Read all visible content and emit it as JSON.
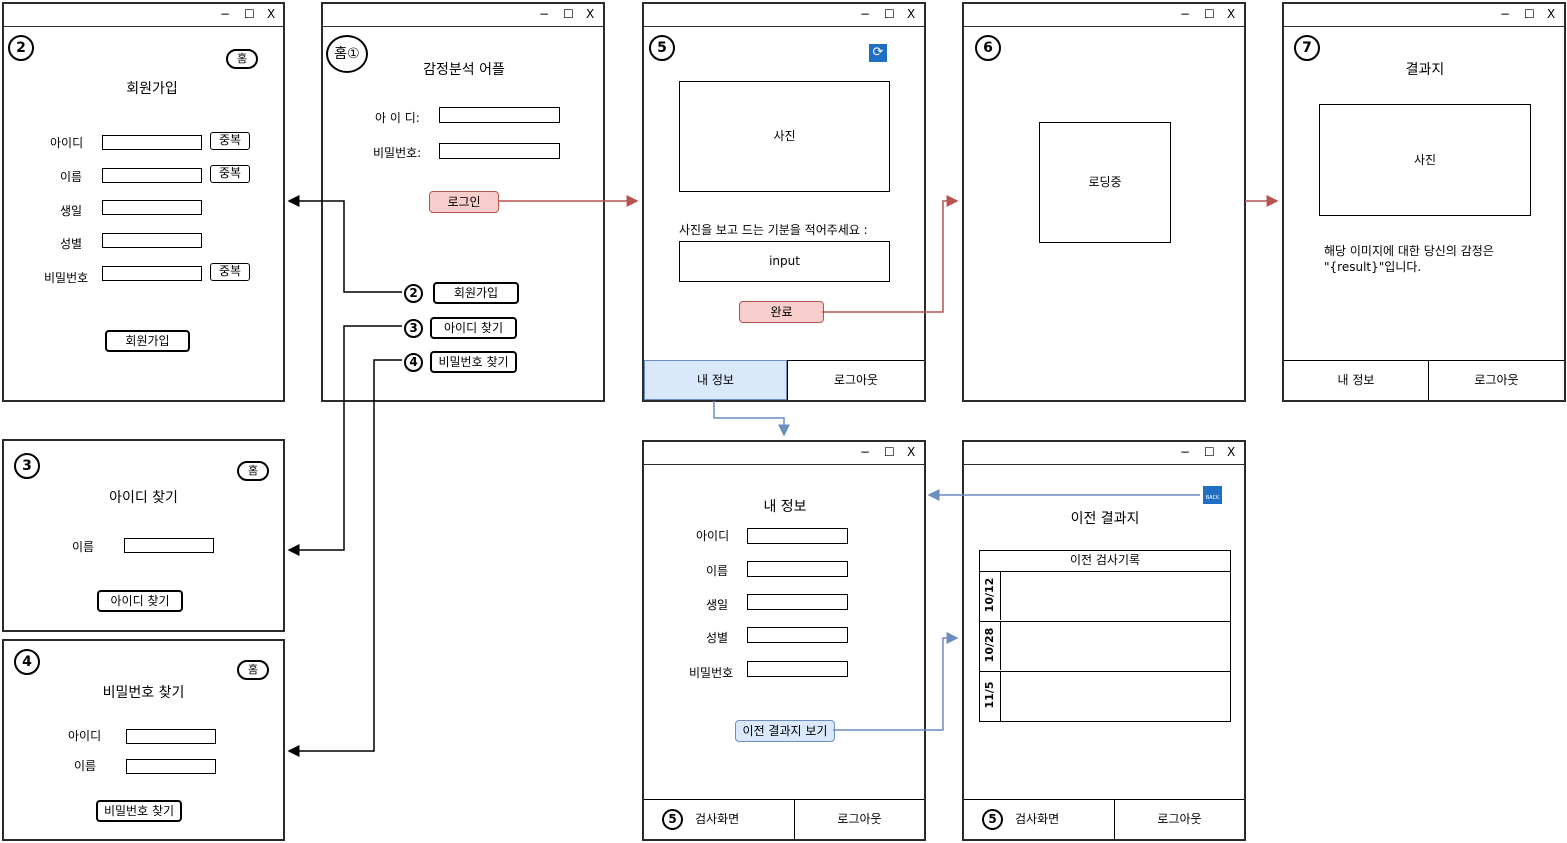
{
  "window_controls": {
    "min": "−",
    "max": "☐",
    "close": "X"
  },
  "home": {
    "num": "홈①",
    "title": "감정분석 어플",
    "id_label": "아 이 디:",
    "pw_label": "비밀번호:",
    "login_button": "로그인",
    "signup_num": "2",
    "signup_button": "회원가입",
    "findid_num": "3",
    "findid_button": "아이디 찾기",
    "findpw_num": "4",
    "findpw_button": "비밀번호 찾기"
  },
  "signup": {
    "num": "2",
    "home_button": "홈",
    "title": "회원가입",
    "fields": [
      "아이디",
      "이름",
      "생일",
      "성별",
      "비밀번호"
    ],
    "dup_button": "중복",
    "submit_button": "회원가입"
  },
  "find_id": {
    "num": "3",
    "home_button": "홈",
    "title": "아이디 찾기",
    "name_label": "이름",
    "submit_button": "아이디 찾기"
  },
  "find_pw": {
    "num": "4",
    "home_button": "홈",
    "title": "비밀번호 찾기",
    "id_label": "아이디",
    "name_label": "이름",
    "submit_button": "비밀번호 찾기"
  },
  "screen5": {
    "num": "5",
    "photo": "사진",
    "prompt": "사진을 보고 드는 기분을 적어주세요 :",
    "input": "input",
    "done_button": "완료",
    "tab_my": "내 정보",
    "tab_logout": "로그아웃"
  },
  "screen6": {
    "num": "6",
    "loading": "로딩중"
  },
  "screen7": {
    "num": "7",
    "title": "결과지",
    "photo": "사진",
    "result_line1": "해당 이미지에 대한 당신의 감정은",
    "result_line2": "\"{result}\"입니다.",
    "tab_my": "내 정보",
    "tab_logout": "로그아웃"
  },
  "my_info": {
    "title": "내 정보",
    "fields": [
      "아이디",
      "이름",
      "생일",
      "성별",
      "비밀번호"
    ],
    "prev_button": "이전 결과지 보기",
    "foot_num": "5",
    "foot_test": "검사화면",
    "foot_logout": "로그아웃"
  },
  "prev_results": {
    "back_icon": "BACK",
    "title": "이전 결과지",
    "table_header": "이전 검사기록",
    "dates": [
      "10/12",
      "10/28",
      "11/5"
    ],
    "foot_num": "5",
    "foot_test": "검사화면",
    "foot_logout": "로그아웃"
  },
  "colors": {
    "red_fill": "#f8cecc",
    "red_line": "#b85450",
    "blue_fill": "#dae8fc",
    "blue_line": "#6c8ebf",
    "refresh_icon": "#1f6fc5"
  }
}
